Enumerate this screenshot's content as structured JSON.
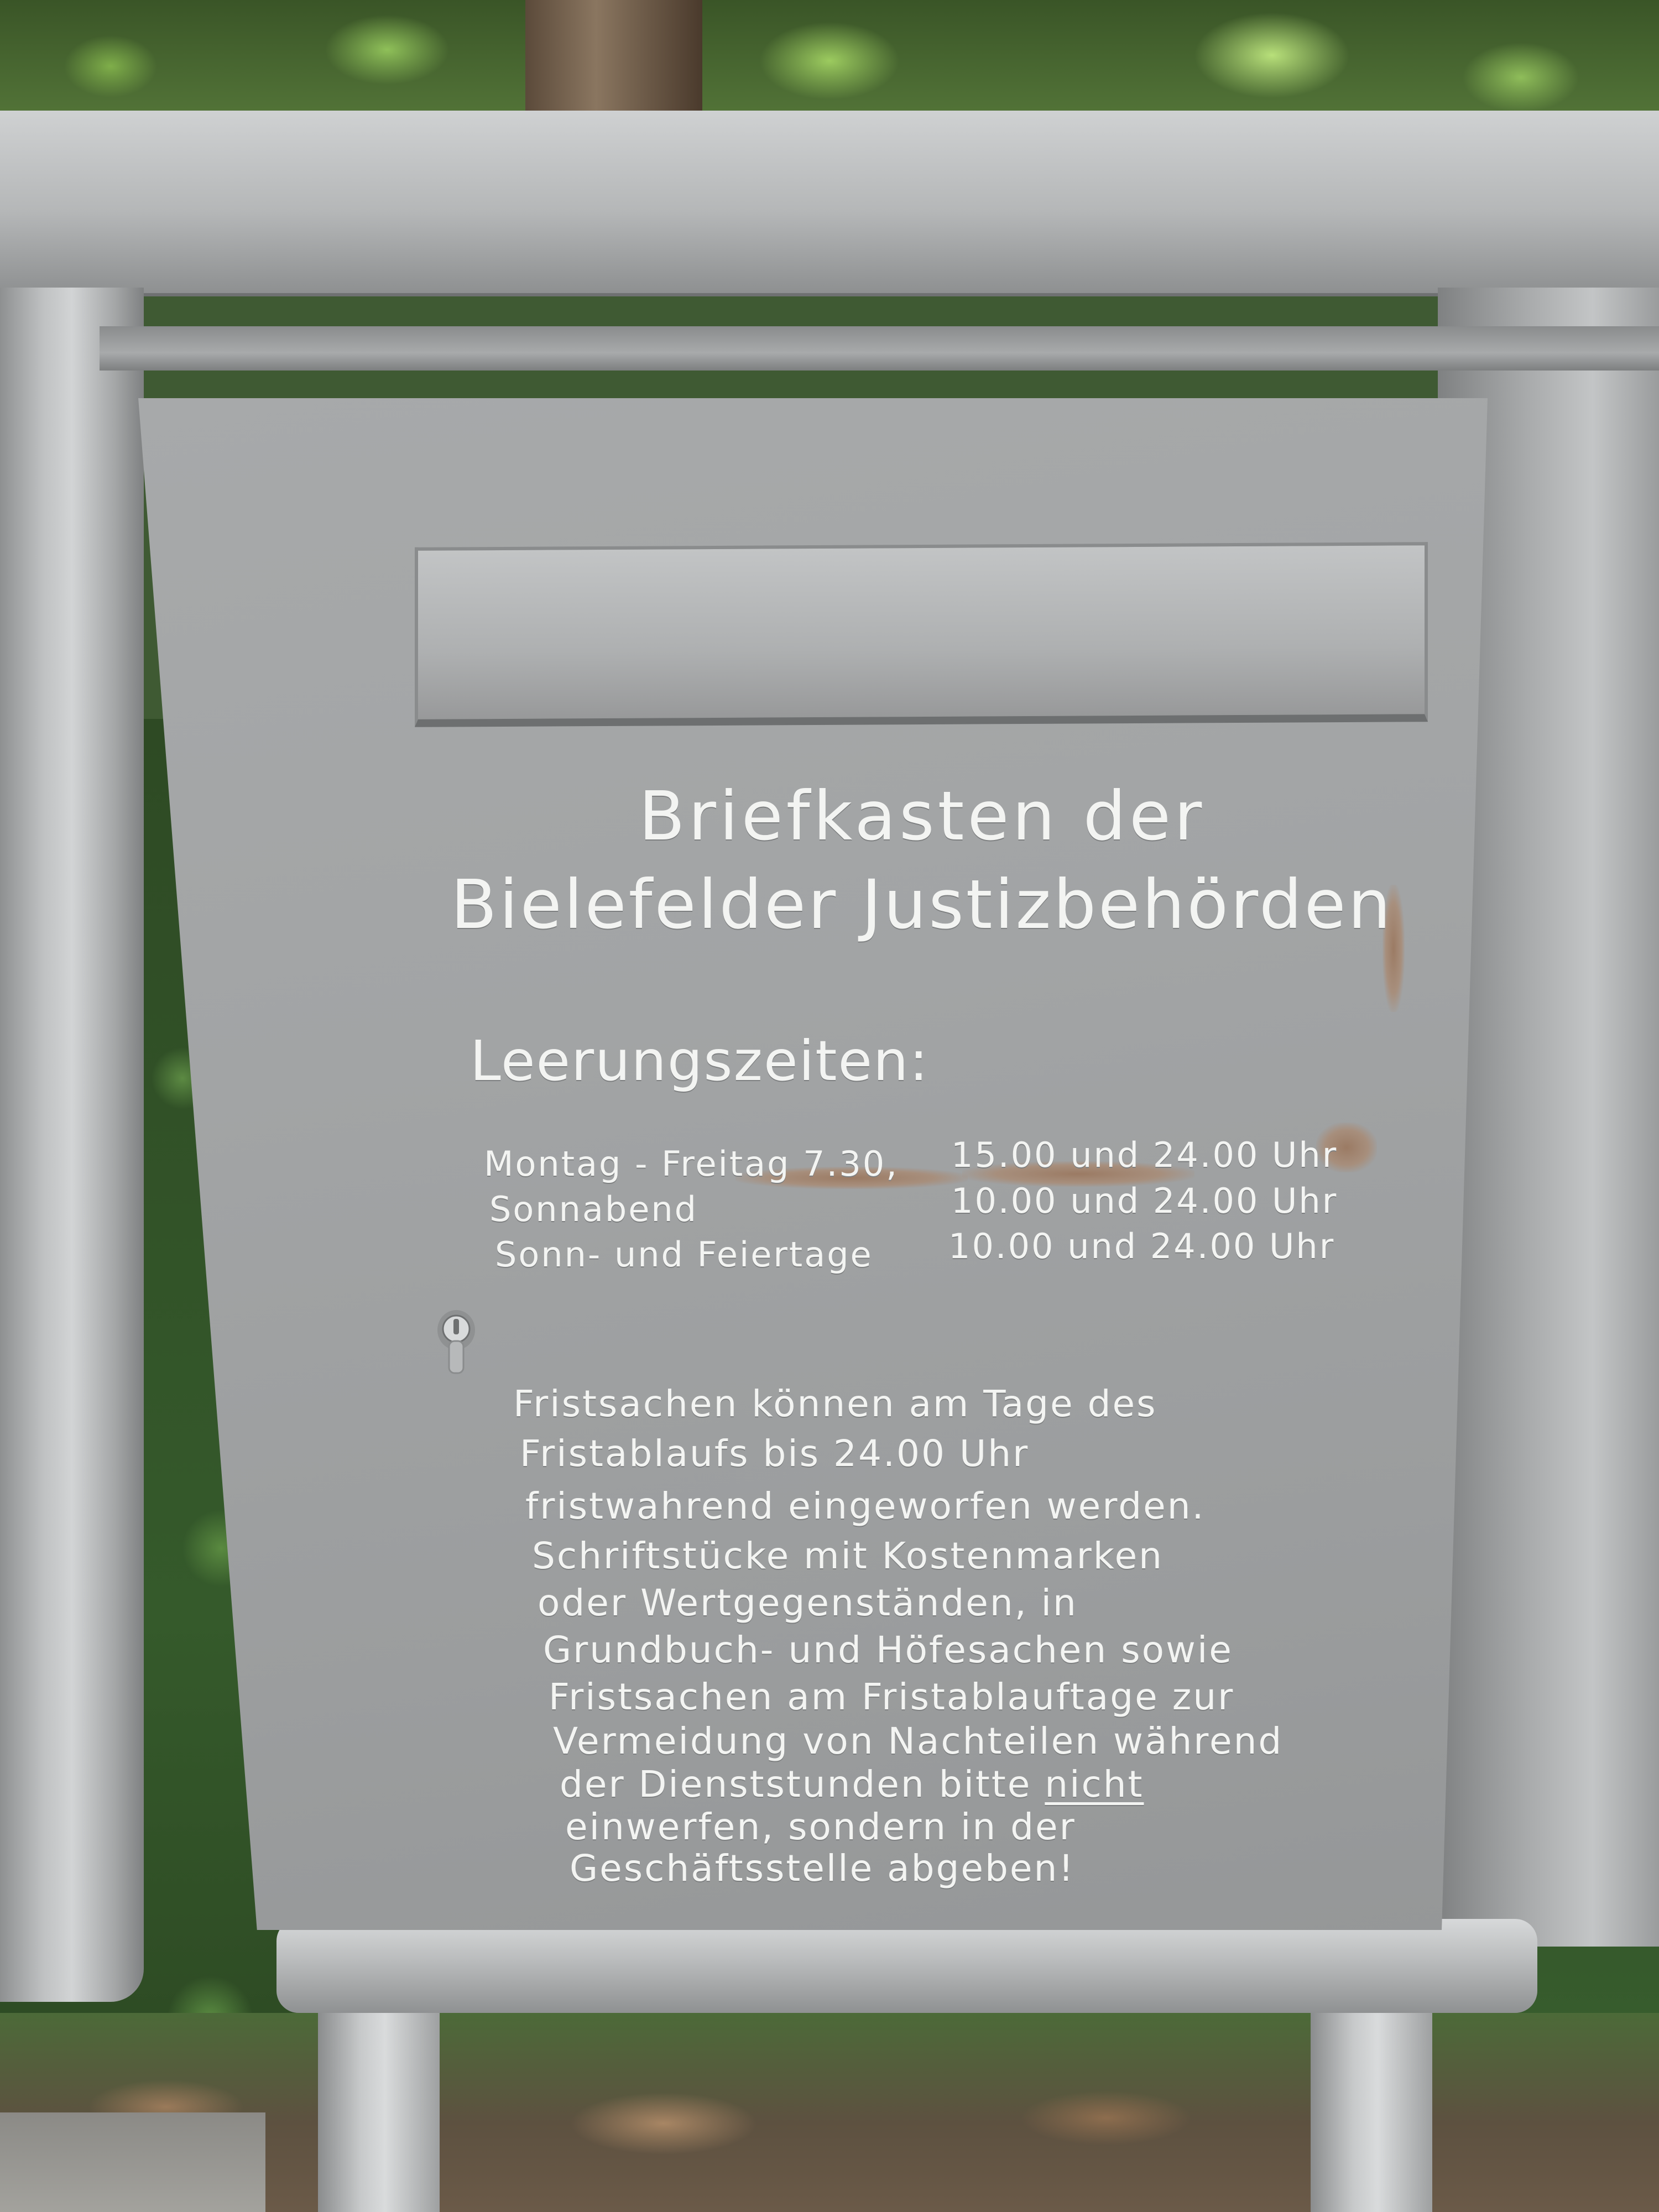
{
  "sign": {
    "title_line1": "Briefkasten der",
    "title_line2": "Bielefelder Justizbehörden",
    "heading": "Leerungszeiten:",
    "schedule": [
      {
        "day": "Montag - Freitag 7.30,",
        "times": "15.00 und 24.00 Uhr"
      },
      {
        "day": "Sonnabend",
        "times": "10.00 und 24.00 Uhr"
      },
      {
        "day": "Sonn- und Feiertage",
        "times": "10.00 und 24.00 Uhr"
      }
    ],
    "notice": [
      "Fristsachen können am Tage des",
      "Fristablaufs bis 24.00 Uhr",
      "fristwahrend eingeworfen werden.",
      "Schriftstücke mit Kostenmarken",
      "oder Wertgegenständen, in",
      "Grundbuch- und Höfesachen sowie",
      "Fristsachen am Fristablauftage zur",
      "Vermeidung von Nachteilen während",
      "der Dienststunden bitte",
      "einwerfen, sondern in der",
      "Geschäftsstelle abgeben!"
    ],
    "notice_emphasis": "nicht"
  },
  "colors": {
    "panel": "#a2a4a5",
    "engraving": "#f3f4f2",
    "foliage": "#3f5a33"
  },
  "icons": {
    "lock": "lock-cylinder-icon"
  }
}
